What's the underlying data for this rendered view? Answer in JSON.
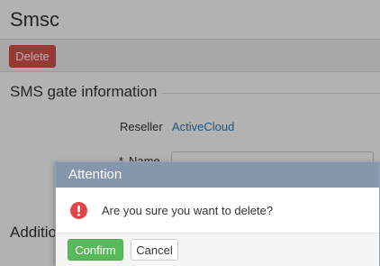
{
  "page": {
    "title": "Smsc"
  },
  "toolbar": {
    "delete_label": "Delete"
  },
  "section": {
    "title": "SMS gate information",
    "fields": {
      "reseller_label": "Reseller",
      "reseller_value": "ActiveCloud",
      "name_required_marker": "*",
      "name_label": "Name",
      "name_value": ""
    }
  },
  "section2": {
    "title": "Additional"
  },
  "dialog": {
    "title": "Attention",
    "icon": "exclamation-circle-icon",
    "message": "Are you sure you want to delete?",
    "confirm_label": "Confirm",
    "cancel_label": "Cancel"
  },
  "colors": {
    "delete_button": "#d9534f",
    "confirm_button": "#5cb85c",
    "dialog_header": "#8597ad",
    "link": "#337ab7",
    "alert_icon": "#e64545"
  }
}
